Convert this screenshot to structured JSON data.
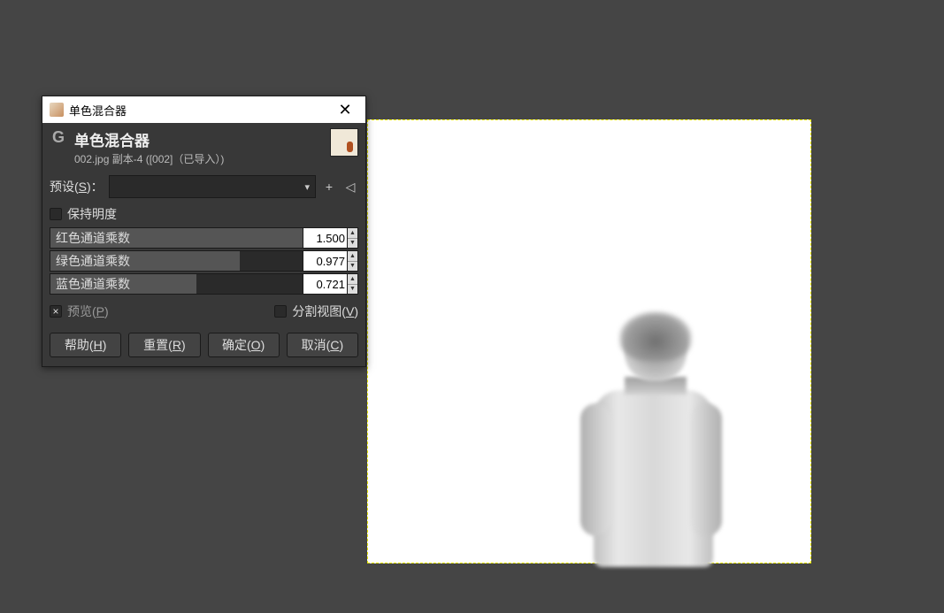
{
  "window": {
    "title": "单色混合器"
  },
  "dialog": {
    "header_title": "单色混合器",
    "header_sub": "002.jpg 副本-4 ([002]（已导入）)",
    "preset_label_pre": "预设(",
    "preset_label_u": "S",
    "preset_label_post": ")：",
    "keep_luminosity": "保持明度",
    "sliders": {
      "red": {
        "label": "红色通道乘数",
        "value": "1.500",
        "fill": 100
      },
      "green": {
        "label": "绿色通道乘数",
        "value": "0.977",
        "fill": 75
      },
      "blue": {
        "label": "蓝色通道乘数",
        "value": "0.721",
        "fill": 58
      }
    },
    "preview_label_pre": "预览(",
    "preview_label_u": "P",
    "preview_label_post": ")",
    "split_label_pre": "分割视图(",
    "split_label_u": "V",
    "split_label_post": ")",
    "buttons": {
      "help_pre": "帮助(",
      "help_u": "H",
      "help_post": ")",
      "reset_pre": "重置(",
      "reset_u": "R",
      "reset_post": ")",
      "ok_pre": "确定(",
      "ok_u": "O",
      "ok_post": ")",
      "cancel_pre": "取消(",
      "cancel_u": "C",
      "cancel_post": ")"
    }
  }
}
